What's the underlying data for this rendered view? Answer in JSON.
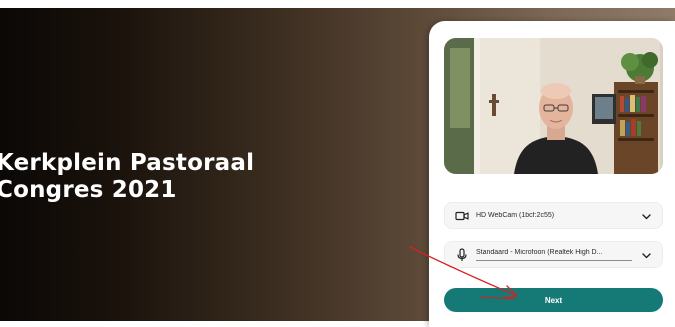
{
  "event": {
    "title_line1": "Kerkplein Pastoraal",
    "title_line2": "Congres 2021"
  },
  "setup": {
    "camera": {
      "label": "HD WebCam (1bcf:2c55)",
      "icon": "video-camera-icon"
    },
    "microphone": {
      "label": "Standaard - Microfoon (Realtek High D...",
      "icon": "microphone-icon"
    },
    "next_label": "Next"
  },
  "colors": {
    "accent": "#157a76",
    "annotation": "#d62020"
  }
}
